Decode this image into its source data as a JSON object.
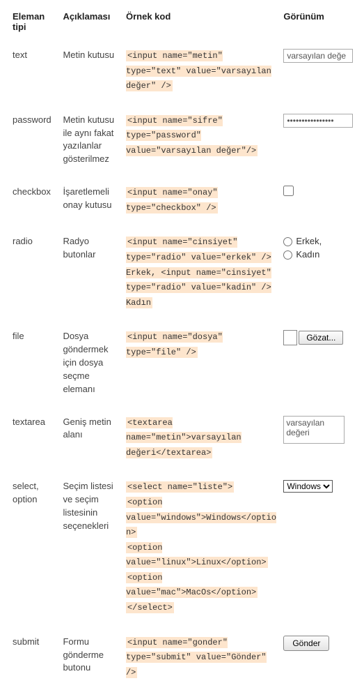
{
  "headers": {
    "type": "Eleman tipi",
    "desc": "Açıklaması",
    "code": "Örnek kod",
    "view": "Görünüm"
  },
  "rows": {
    "text": {
      "type": "text",
      "desc": "Metin kutusu",
      "code": "<input name=\"metin\" type=\"text\" value=\"varsayılan değer\" />",
      "value": "varsayılan değe"
    },
    "password": {
      "type": "password",
      "desc": "Metin kutusu ile aynı fakat yazılanlar gösterilmez",
      "code": "<input name=\"sifre\" type=\"password\" value=\"varsayılan değer\"/>",
      "value": "varsayılan değer"
    },
    "checkbox": {
      "type": "checkbox",
      "desc": "İşaretlemeli onay kutusu",
      "code": "<input name=\"onay\" type=\"checkbox\" />"
    },
    "radio": {
      "type": "radio",
      "desc": "Radyo butonlar",
      "code": "<input name=\"cinsiyet\" type=\"radio\" value=\"erkek\" /> Erkek, <input name=\"cinsiyet\" type=\"radio\" value=\"kadin\" /> Kadın",
      "opt1": "Erkek,",
      "opt2": "Kadın"
    },
    "file": {
      "type": "file",
      "desc": "Dosya göndermek için dosya seçme elemanı",
      "code": "<input name=\"dosya\" type=\"file\" />",
      "button": "Gözat..."
    },
    "textarea": {
      "type": "textarea",
      "desc": "Geniş metin alanı",
      "code": "<textarea name=\"metin\">varsayılan değeri</textarea>",
      "value": "varsayılan değeri"
    },
    "select": {
      "type": "select, option",
      "desc": "Seçim listesi ve seçim listesinin seçenekleri",
      "code_lines": {
        "l1": "<select name=\"liste\">",
        "l2": "<option value=\"windows\">Windows</option>",
        "l3": "<option value=\"linux\">Linux</option>",
        "l4": "<option value=\"mac\">MacOs</option>",
        "l5": "</select>"
      },
      "selected": "Windows"
    },
    "submit": {
      "type": "submit",
      "desc": "Formu gönderme butonu",
      "code": "<input name=\"gonder\" type=\"submit\" value=\"Gönder\" />",
      "button": "Gönder"
    }
  }
}
